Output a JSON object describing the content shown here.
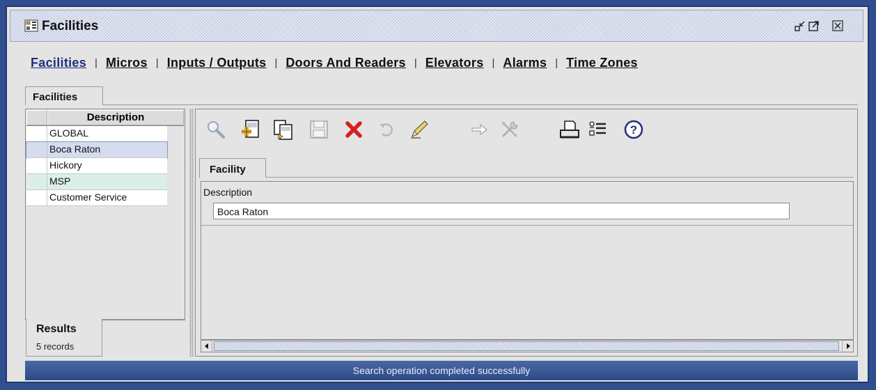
{
  "window": {
    "title": "Facilities",
    "icons": [
      "building-grid-icon",
      "minimize-icon",
      "maximize-icon",
      "close-icon"
    ]
  },
  "nav": {
    "items": [
      {
        "label": "Facilities",
        "active": true
      },
      {
        "label": "Micros"
      },
      {
        "label": "Inputs / Outputs"
      },
      {
        "label": "Doors And Readers"
      },
      {
        "label": "Elevators"
      },
      {
        "label": "Alarms"
      },
      {
        "label": "Time Zones"
      }
    ],
    "separator": "|"
  },
  "main_tab": {
    "label": "Facilities"
  },
  "list": {
    "column_header": "Description",
    "rows": [
      {
        "description": "GLOBAL"
      },
      {
        "description": "Boca Raton",
        "selected": true
      },
      {
        "description": "Hickory"
      },
      {
        "description": "MSP"
      },
      {
        "description": "Customer Service"
      }
    ],
    "results_label": "Results",
    "records_count": "5 records"
  },
  "toolbar": {
    "buttons": [
      "search-icon",
      "add-record-icon",
      "copy-record-icon",
      "save-icon",
      "delete-icon",
      "undo-icon",
      "edit-pencil-icon",
      "forward-arrow-icon",
      "tools-icon",
      "print-icon",
      "list-options-icon",
      "help-icon"
    ]
  },
  "detail": {
    "tab_label": "Facility",
    "description_label": "Description",
    "description_value": "Boca Raton"
  },
  "status": {
    "message": "Search operation completed successfully"
  },
  "colors": {
    "accent": "#1e2f7c",
    "statusbar": "#3a5797",
    "frame": "#2f4f8f"
  }
}
